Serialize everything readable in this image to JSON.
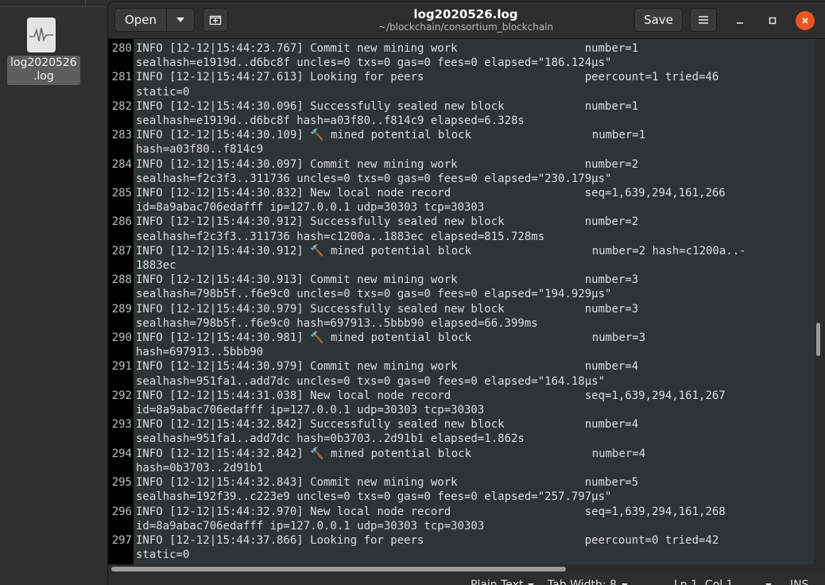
{
  "desktop": {
    "file_icon_label_line1": "log2020526",
    "file_icon_label_line2": ".log"
  },
  "window": {
    "title": "log2020526.log",
    "subtitle": "~/blockchain/consortium_blockchain",
    "open_label": "Open",
    "save_label": "Save"
  },
  "statusbar": {
    "language": "Plain Text",
    "tab_width": "Tab Width: 8",
    "position": "Ln 1, Col 1",
    "mode": "INS"
  },
  "colors": {
    "close_button": "#e95420",
    "editor_bg": "#2e3436",
    "gutter_bg": "#000000"
  },
  "lines": [
    {
      "n": "280",
      "t": "INFO [12-12|15:44:23.767] Commit new mining work                   number=1"
    },
    {
      "n": "",
      "t": "sealhash=e1919d..d6bc8f uncles=0 txs=0 gas=0 fees=0 elapsed=\"186.124µs\""
    },
    {
      "n": "281",
      "t": "INFO [12-12|15:44:27.613] Looking for peers                        peercount=1 tried=46"
    },
    {
      "n": "",
      "t": "static=0"
    },
    {
      "n": "282",
      "t": "INFO [12-12|15:44:30.096] Successfully sealed new block            number=1"
    },
    {
      "n": "",
      "t": "sealhash=e1919d..d6bc8f hash=a03f80..f814c9 elapsed=6.328s"
    },
    {
      "n": "283",
      "t": "INFO [12-12|15:44:30.109] 🔨 mined potential block                  number=1"
    },
    {
      "n": "",
      "t": "hash=a03f80..f814c9"
    },
    {
      "n": "284",
      "t": "INFO [12-12|15:44:30.097] Commit new mining work                   number=2"
    },
    {
      "n": "",
      "t": "sealhash=f2c3f3..311736 uncles=0 txs=0 gas=0 fees=0 elapsed=\"230.179µs\""
    },
    {
      "n": "285",
      "t": "INFO [12-12|15:44:30.832] New local node record                    seq=1,639,294,161,266"
    },
    {
      "n": "",
      "t": "id=8a9abac706edafff ip=127.0.0.1 udp=30303 tcp=30303"
    },
    {
      "n": "286",
      "t": "INFO [12-12|15:44:30.912] Successfully sealed new block            number=2"
    },
    {
      "n": "",
      "t": "sealhash=f2c3f3..311736 hash=c1200a..1883ec elapsed=815.728ms"
    },
    {
      "n": "287",
      "t": "INFO [12-12|15:44:30.912] 🔨 mined potential block                  number=2 hash=c1200a..-"
    },
    {
      "n": "",
      "t": "1883ec"
    },
    {
      "n": "288",
      "t": "INFO [12-12|15:44:30.913] Commit new mining work                   number=3"
    },
    {
      "n": "",
      "t": "sealhash=798b5f..f6e9c0 uncles=0 txs=0 gas=0 fees=0 elapsed=\"194.929µs\""
    },
    {
      "n": "289",
      "t": "INFO [12-12|15:44:30.979] Successfully sealed new block            number=3"
    },
    {
      "n": "",
      "t": "sealhash=798b5f..f6e9c0 hash=697913..5bbb90 elapsed=66.399ms"
    },
    {
      "n": "290",
      "t": "INFO [12-12|15:44:30.981] 🔨 mined potential block                  number=3"
    },
    {
      "n": "",
      "t": "hash=697913..5bbb90"
    },
    {
      "n": "291",
      "t": "INFO [12-12|15:44:30.979] Commit new mining work                   number=4"
    },
    {
      "n": "",
      "t": "sealhash=951fa1..add7dc uncles=0 txs=0 gas=0 fees=0 elapsed=\"164.18µs\""
    },
    {
      "n": "292",
      "t": "INFO [12-12|15:44:31.038] New local node record                    seq=1,639,294,161,267"
    },
    {
      "n": "",
      "t": "id=8a9abac706edafff ip=127.0.0.1 udp=30303 tcp=30303"
    },
    {
      "n": "293",
      "t": "INFO [12-12|15:44:32.842] Successfully sealed new block            number=4"
    },
    {
      "n": "",
      "t": "sealhash=951fa1..add7dc hash=0b3703..2d91b1 elapsed=1.862s"
    },
    {
      "n": "294",
      "t": "INFO [12-12|15:44:32.842] 🔨 mined potential block                  number=4"
    },
    {
      "n": "",
      "t": "hash=0b3703..2d91b1"
    },
    {
      "n": "295",
      "t": "INFO [12-12|15:44:32.843] Commit new mining work                   number=5"
    },
    {
      "n": "",
      "t": "sealhash=192f39..c223e9 uncles=0 txs=0 gas=0 fees=0 elapsed=\"257.797µs\""
    },
    {
      "n": "296",
      "t": "INFO [12-12|15:44:32.970] New local node record                    seq=1,639,294,161,268"
    },
    {
      "n": "",
      "t": "id=8a9abac706edafff ip=127.0.0.1 udp=30303 tcp=30303"
    },
    {
      "n": "297",
      "t": "INFO [12-12|15:44:37.866] Looking for peers                        peercount=0 tried=42"
    },
    {
      "n": "",
      "t": "static=0"
    }
  ]
}
